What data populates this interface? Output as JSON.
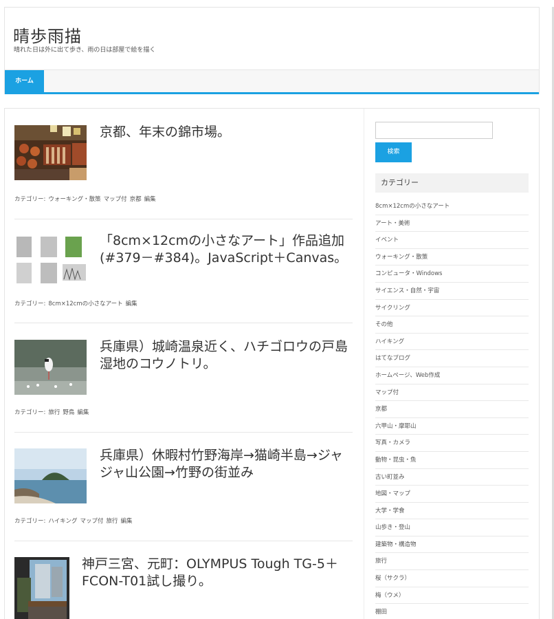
{
  "site": {
    "title": "晴歩雨描",
    "description": "晴れた日は外に出て歩き、雨の日は部屋で絵を描く"
  },
  "nav": {
    "home": "ホーム"
  },
  "posts": [
    {
      "title": "京都、年末の錦市場。",
      "meta": [
        "カテゴリー:",
        "ウォーキング・散策",
        "マップ付",
        "京都",
        "編集"
      ]
    },
    {
      "title": "「8cm×12cmの小さなアート」作品追加(#379－#384)。JavaScript＋Canvas。",
      "meta": [
        "カテゴリー:",
        "8cm×12cmの小さなアート",
        "編集"
      ]
    },
    {
      "title": "兵庫県）城崎温泉近く、ハチゴロウの戸島湿地のコウノトリ。",
      "meta": [
        "カテゴリー:",
        "旅行",
        "野鳥",
        "編集"
      ]
    },
    {
      "title": "兵庫県）休暇村竹野海岸→猫崎半島→ジャジャ山公園→竹野の街並み",
      "meta": [
        "カテゴリー:",
        "ハイキング",
        "マップ付",
        "旅行",
        "編集"
      ]
    },
    {
      "title": "神戸三宮、元町：OLYMPUS Tough TG-5＋FCON-T01試し撮り。"
    }
  ],
  "sidebar": {
    "search_button": "検索",
    "categories_heading": "カテゴリー",
    "categories": [
      "8cm×12cmの小さなアート",
      "アート・美術",
      "イベント",
      "ウォーキング・散策",
      "コンピュータ・Windows",
      "サイエンス・自然・宇宙",
      "サイクリング",
      "その他",
      "ハイキング",
      "はてなブログ",
      "ホームページ、Web作成",
      "マップ付",
      "京都",
      "六甲山・摩耶山",
      "写真・カメラ",
      "動物・昆虫・魚",
      "古い町並み",
      "地図・マップ",
      "大学・学食",
      "山歩き・登山",
      "建築物・構造物",
      "旅行",
      "桜（サクラ）",
      "梅（ウメ）",
      "棚田"
    ]
  },
  "colors": {
    "accent": "#1ba1e2"
  }
}
